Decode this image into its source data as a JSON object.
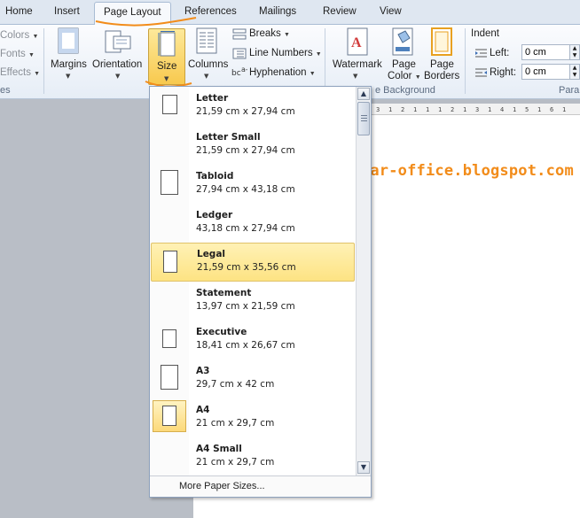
{
  "tabs": [
    "Home",
    "Insert",
    "Page Layout",
    "References",
    "Mailings",
    "Review",
    "View"
  ],
  "ribbon": {
    "themes_items": [
      "Colors",
      "Fonts",
      "Effects"
    ],
    "themes_group_cut": "es",
    "margins": "Margins",
    "orientation": "Orientation",
    "size": "Size",
    "columns": "Columns",
    "breaks": "Breaks",
    "line_numbers": "Line Numbers",
    "hyphenation": "Hyphenation",
    "watermark": "Watermark",
    "page_color_1": "Page",
    "page_color_2": "Color",
    "page_borders_1": "Page",
    "page_borders_2": "Borders",
    "page_background_group": "e Background",
    "indent_title": "Indent",
    "left_label": "Left:",
    "left_value": "0 cm",
    "right_label": "Right:",
    "right_value": "0 cm",
    "paragraph_group_cut": "Para"
  },
  "watermark_url": "http://dasar-office.blogspot.com",
  "ruler_ticks": [
    "3",
    "1",
    "2",
    "1",
    "1",
    "1",
    "2",
    "1",
    "3",
    "1",
    "4",
    "1",
    "5",
    "1",
    "6",
    "1"
  ],
  "sizes": [
    {
      "name": "Letter",
      "dims": "21,59 cm x 27,94 cm"
    },
    {
      "name": "Letter Small",
      "dims": "21,59 cm x 27,94 cm"
    },
    {
      "name": "Tabloid",
      "dims": "27,94 cm x 43,18 cm"
    },
    {
      "name": "Ledger",
      "dims": "43,18 cm x 27,94 cm"
    },
    {
      "name": "Legal",
      "dims": "21,59 cm x 35,56 cm"
    },
    {
      "name": "Statement",
      "dims": "13,97 cm x 21,59 cm"
    },
    {
      "name": "Executive",
      "dims": "18,41 cm x 26,67 cm"
    },
    {
      "name": "A3",
      "dims": "29,7 cm x 42 cm"
    },
    {
      "name": "A4",
      "dims": "21 cm x 29,7 cm"
    },
    {
      "name": "A4 Small",
      "dims": "21 cm x 29,7 cm"
    }
  ],
  "selected_size": "Legal",
  "current_size": "A4",
  "more_paper_sizes": "More Paper Sizes...",
  "colors": {
    "accent_orange": "#f28c1a",
    "selected_highlight": "#fde383"
  }
}
